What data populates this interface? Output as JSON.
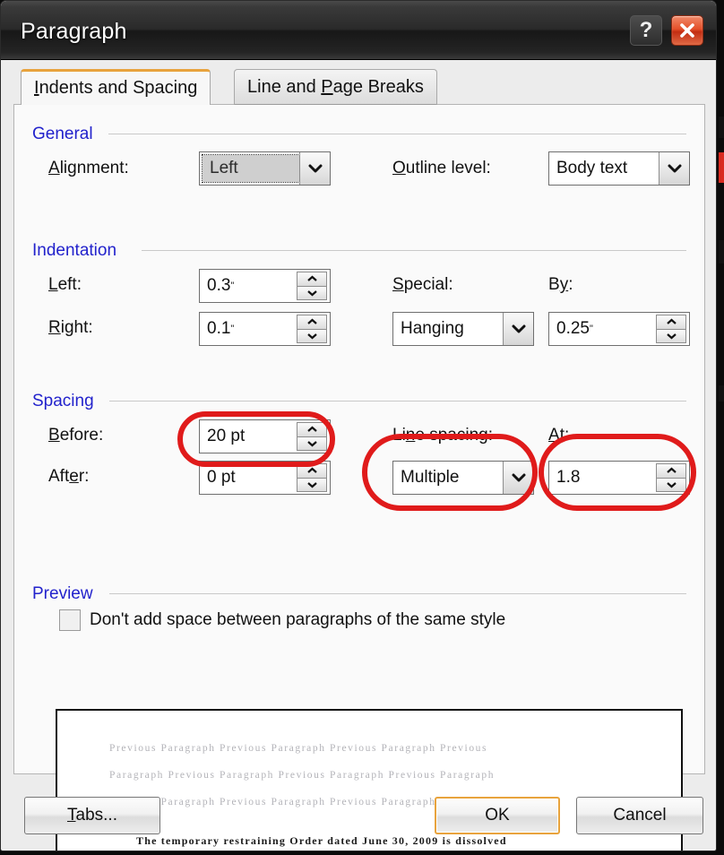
{
  "window": {
    "title": "Paragraph",
    "help_button": "?",
    "close_button": "close-icon"
  },
  "tabs": [
    {
      "label": "Indents and Spacing",
      "accel": "I",
      "active": true
    },
    {
      "label": "Line and Page Breaks",
      "accel": "P",
      "active": false
    }
  ],
  "general": {
    "heading": "General",
    "alignment": {
      "label": "Alignment:",
      "accel": "A",
      "value": "Left",
      "focused": true
    },
    "outline_level": {
      "label": "Outline level:",
      "accel": "O",
      "value": "Body text"
    }
  },
  "indentation": {
    "heading": "Indentation",
    "left": {
      "label": "Left:",
      "accel": "L",
      "value": "0.3",
      "unit": "\""
    },
    "right": {
      "label": "Right:",
      "accel": "R",
      "value": "0.1",
      "unit": "\""
    },
    "special": {
      "label": "Special:",
      "accel": "S",
      "value": "Hanging"
    },
    "by": {
      "label": "By:",
      "accel": "y",
      "value": "0.25",
      "unit": "\""
    }
  },
  "spacing": {
    "heading": "Spacing",
    "before": {
      "label": "Before:",
      "accel": "B",
      "value": "20 pt",
      "highlighted": true
    },
    "after": {
      "label": "After:",
      "accel": "e",
      "value": "0 pt"
    },
    "line_spacing": {
      "label": "Line spacing:",
      "accel": "n",
      "value": "Multiple",
      "highlighted": true
    },
    "at": {
      "label": "At:",
      "accel": "A",
      "value": "1.8",
      "highlighted": true
    },
    "dont_add_space": {
      "label": "Don't add space between paragraphs of the same style",
      "checked": false
    }
  },
  "preview": {
    "heading": "Preview",
    "lines": [
      "Previous Paragraph Previous Paragraph Previous Paragraph Previous",
      "Paragraph Previous Paragraph Previous Paragraph Previous Paragraph",
      "Previous Paragraph Previous Paragraph Previous Paragraph"
    ],
    "sample_text": "The temporary restraining Order dated June 30, 2009 is dissolved"
  },
  "buttons": {
    "tabs": "Tabs...",
    "tabs_accel": "T",
    "ok": "OK",
    "cancel": "Cancel"
  },
  "colors": {
    "group_heading": "#2222cc",
    "accent_orange": "#e8a33d",
    "annotation_red": "#e01b1b",
    "close_red": "#e4502a"
  }
}
